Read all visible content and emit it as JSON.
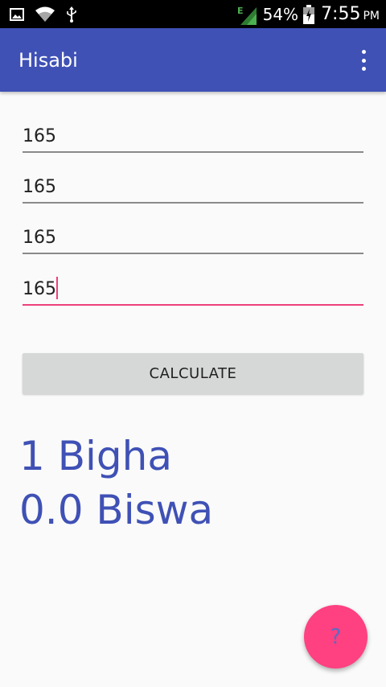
{
  "status_bar": {
    "battery_percent": "54%",
    "time": "7:55",
    "ampm": "PM",
    "icons": [
      "image-icon",
      "wifi-icon",
      "usb-icon",
      "signal-icon",
      "battery-icon"
    ]
  },
  "app_bar": {
    "title": "Hisabi",
    "overflow_icon": "more-vert-icon"
  },
  "inputs": [
    {
      "value": "165"
    },
    {
      "value": "165"
    },
    {
      "value": "165"
    },
    {
      "value": "165"
    }
  ],
  "calculate_button": {
    "label": "CALCULATE"
  },
  "result": {
    "bigha": "1 Bigha",
    "biswa": "0.0 Biswa"
  },
  "fab": {
    "label": "?",
    "icon": "help-icon"
  },
  "colors": {
    "primary": "#3f51b5",
    "accent": "#ff4081",
    "focus_underline": "#ec407a",
    "button_bg": "#d6d7d7"
  }
}
